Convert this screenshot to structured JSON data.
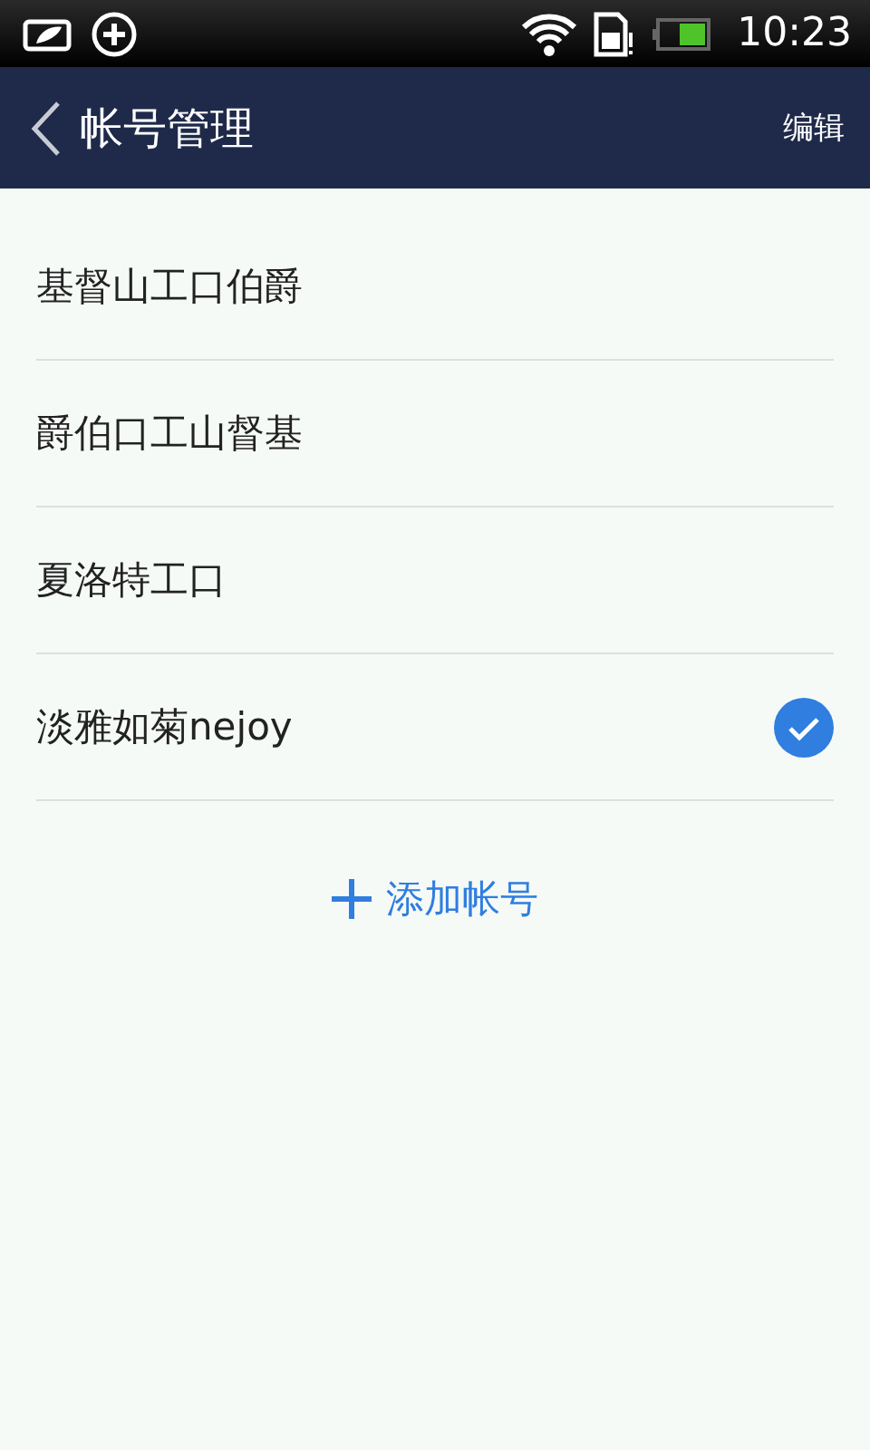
{
  "status_bar": {
    "time": "10:23"
  },
  "header": {
    "title": "帐号管理",
    "action": "编辑"
  },
  "accounts": [
    {
      "name": "基督山工口伯爵",
      "selected": false
    },
    {
      "name": "爵伯口工山督基",
      "selected": false
    },
    {
      "name": "夏洛特工口",
      "selected": false
    },
    {
      "name": "淡雅如菊nejoy",
      "selected": true
    }
  ],
  "add_button": {
    "label": "添加帐号"
  }
}
